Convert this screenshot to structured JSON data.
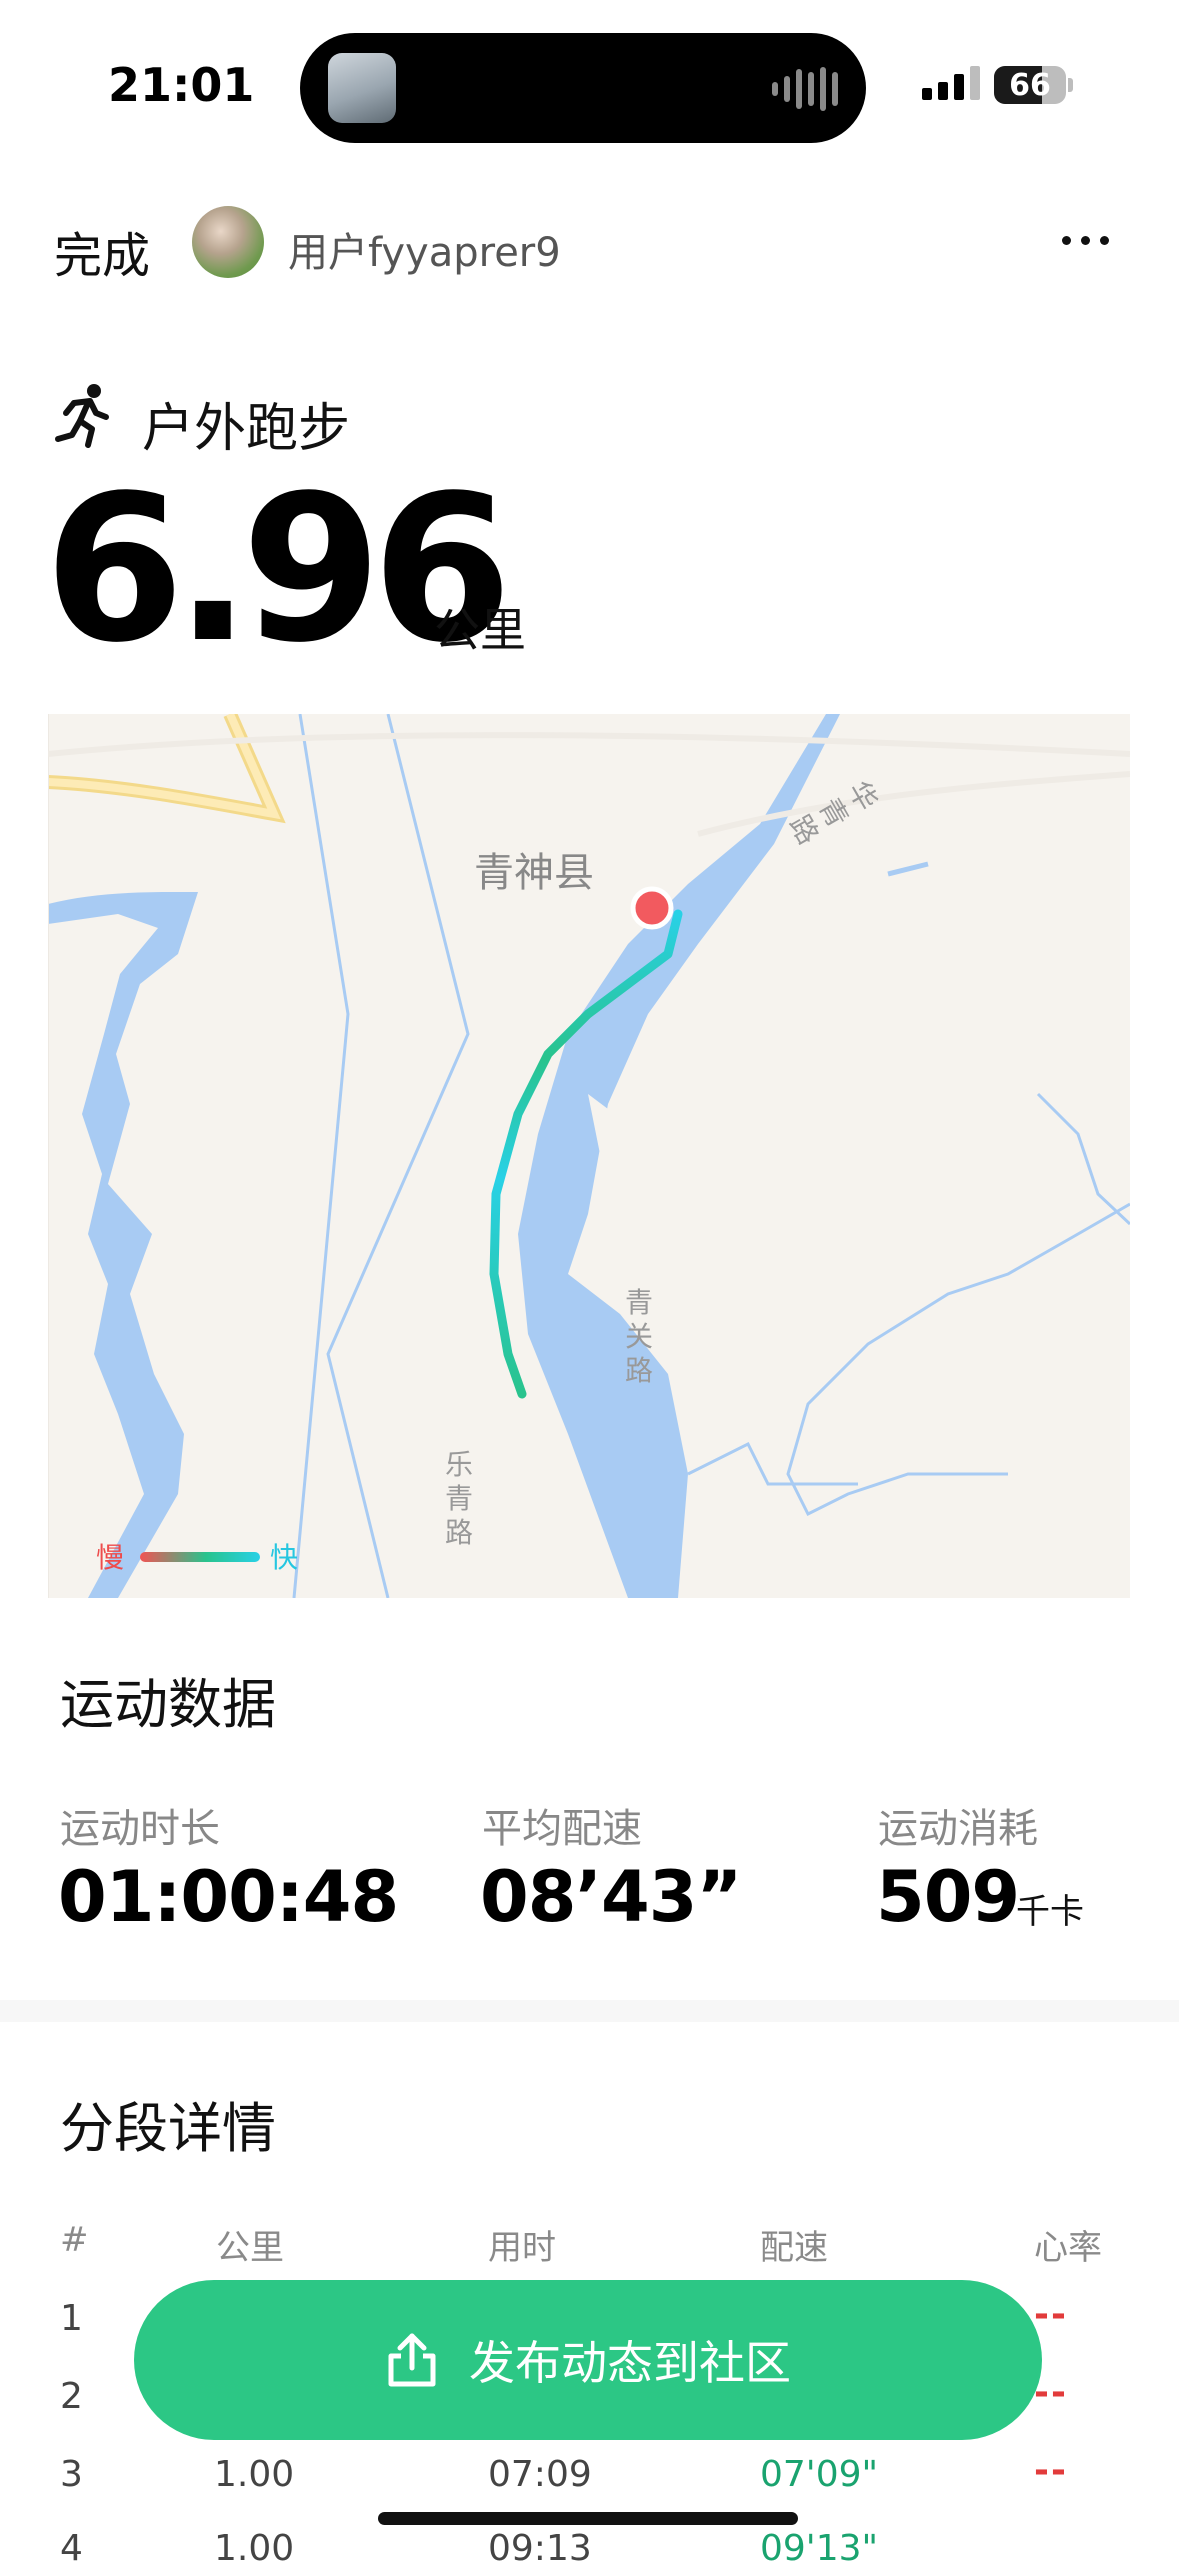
{
  "status_bar": {
    "time": "21:01",
    "battery": "66",
    "battery_level": 0.66,
    "icons": [
      "signal-icon",
      "battery-icon",
      "voice-activity-icon"
    ]
  },
  "nav": {
    "done_label": "完成",
    "username": "用户fyyaprer9",
    "more_icon": "more-icon"
  },
  "activity": {
    "icon": "running-icon",
    "title": "户外跑步",
    "distance": "6.96",
    "distance_unit": "公里"
  },
  "map": {
    "county_label": "青神县",
    "road_labels": [
      "华青路",
      "青关路",
      "乐青路"
    ],
    "legend_slow": "慢",
    "legend_fast": "快",
    "route_colors": {
      "slow": "#f25353",
      "mid": "#29c38d",
      "fast": "#29d1e6"
    },
    "water_color": "#a8cbf3",
    "land_color": "#f6f3ee"
  },
  "stats": {
    "title": "运动数据",
    "items": [
      {
        "label": "运动时长",
        "value": "01:00:48",
        "unit": ""
      },
      {
        "label": "平均配速",
        "value": "08’43”",
        "unit": ""
      },
      {
        "label": "运动消耗",
        "value": "509",
        "unit": "千卡"
      }
    ]
  },
  "splits": {
    "title": "分段详情",
    "headers": [
      "#",
      "公里",
      "用时",
      "配速",
      "心率"
    ],
    "rows": [
      {
        "index": "1",
        "km": "",
        "time": "",
        "pace": "",
        "hr": "--"
      },
      {
        "index": "2",
        "km": "",
        "time": "",
        "pace": "",
        "hr": "--"
      },
      {
        "index": "3",
        "km": "1.00",
        "time": "07:09",
        "pace": "07'09\"",
        "hr": "--"
      },
      {
        "index": "4",
        "km": "1.00",
        "time": "09:13",
        "pace": "09'13\"",
        "hr": ""
      }
    ]
  },
  "publish": {
    "label": "发布动态到社区",
    "icon": "share-icon",
    "color": "#2cc785"
  }
}
